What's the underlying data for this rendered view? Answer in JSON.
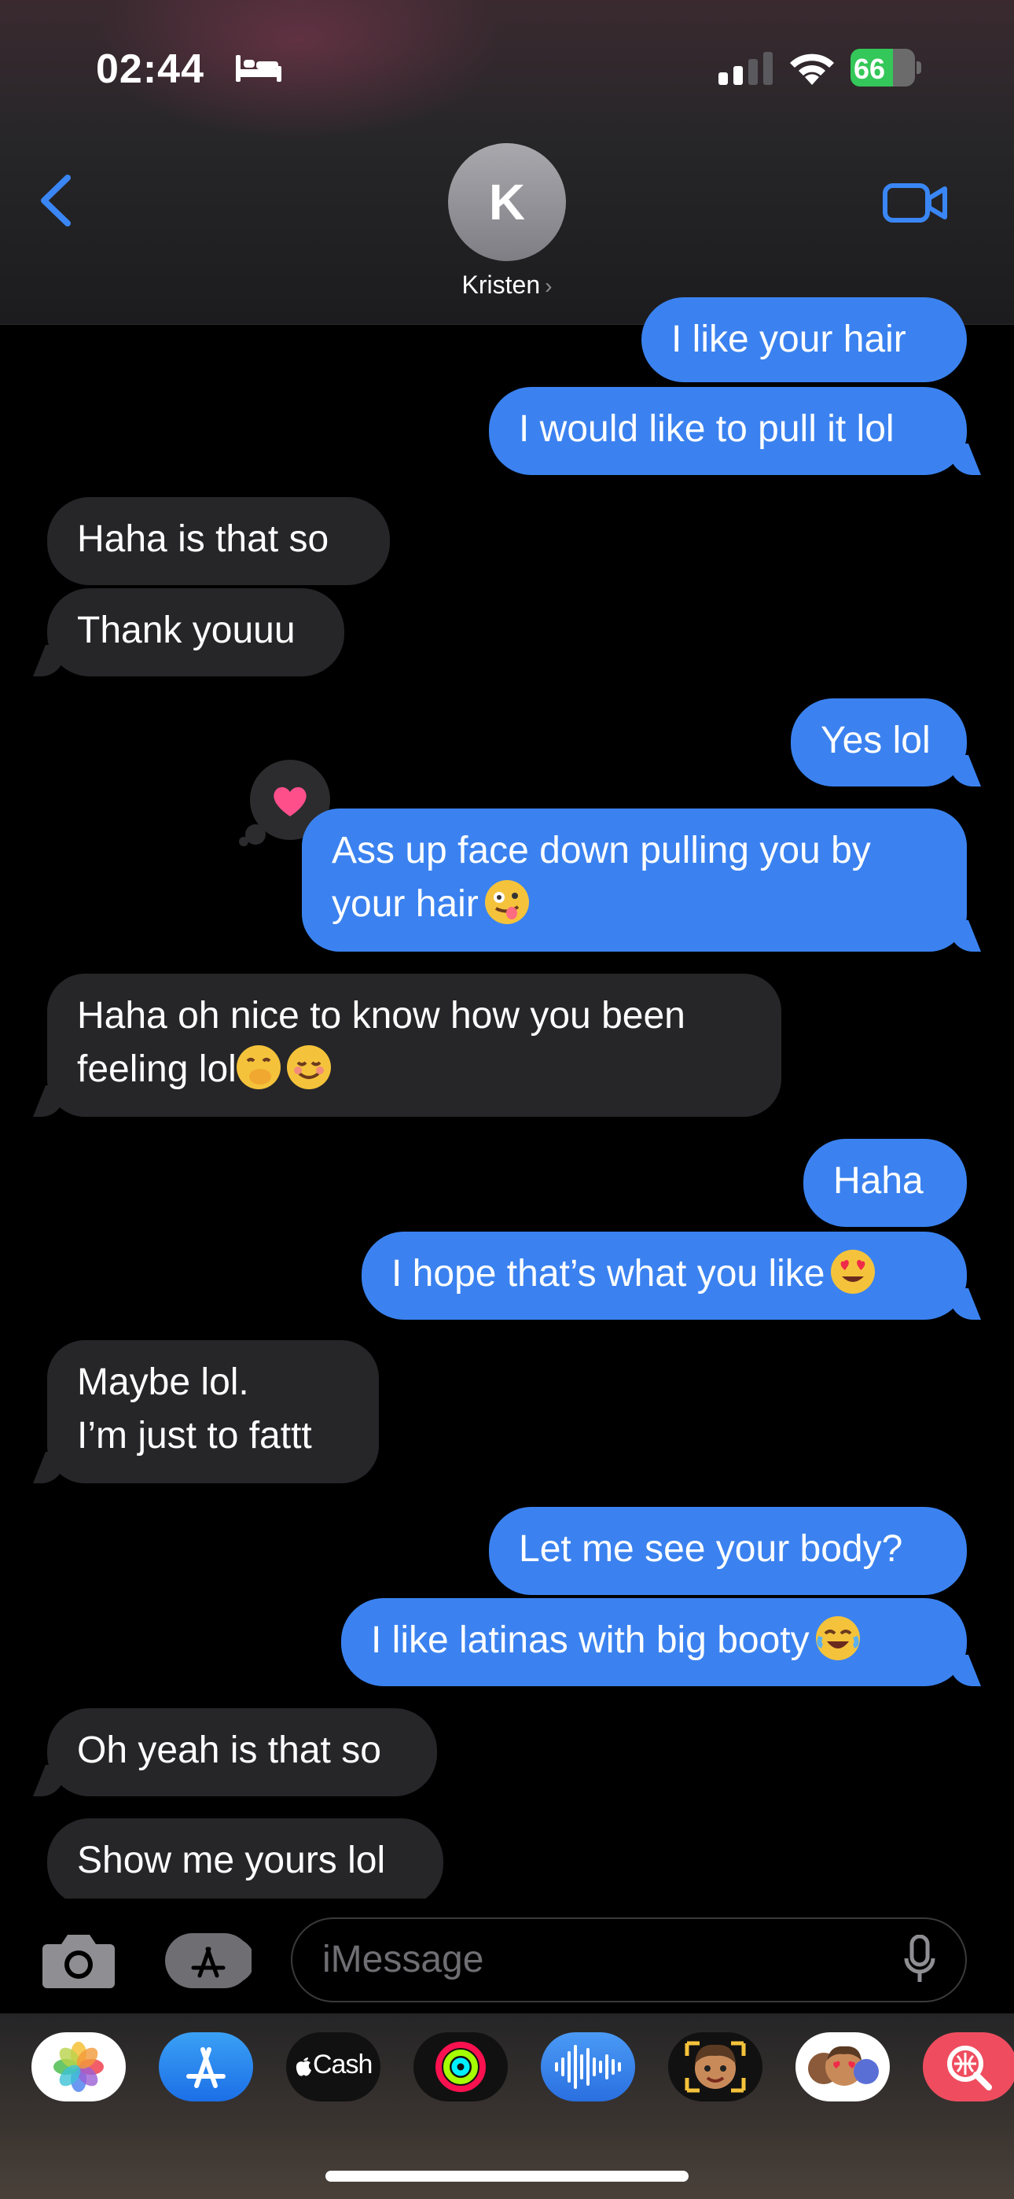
{
  "status_bar": {
    "time": "02:44",
    "battery": "66",
    "battery_fraction": 0.66
  },
  "header": {
    "avatar_initial": "K",
    "contact_name": "Kristen",
    "chevron": "›"
  },
  "messages": [
    {
      "side": "out",
      "text": "I like your hair"
    },
    {
      "side": "out",
      "text": "I would like to pull it lol"
    },
    {
      "side": "in",
      "text": "Haha is that so"
    },
    {
      "side": "in",
      "text": "Thank youuu"
    },
    {
      "side": "out",
      "text": "Yes lol"
    },
    {
      "side": "out",
      "line1": "Ass up face down pulling you by",
      "line2": "your hair",
      "emoji": "zany-face",
      "tapback": "heart"
    },
    {
      "side": "in",
      "line1": "Haha oh nice to know how you been",
      "line2": "feeling lol",
      "emoji": [
        "hand-over-mouth",
        "smiling-face"
      ]
    },
    {
      "side": "out",
      "text": "Haha"
    },
    {
      "side": "out",
      "text": "I hope that’s what you like",
      "emoji": "heart-eyes"
    },
    {
      "side": "in",
      "line1": "Maybe lol.",
      "line2": "I’m just to fattt"
    },
    {
      "side": "out",
      "text": "Let me see your body?"
    },
    {
      "side": "out",
      "text": "I like latinas with big booty",
      "emoji": "tears-of-joy"
    },
    {
      "side": "in",
      "text": "Oh yeah is that so"
    },
    {
      "side": "in",
      "text": "Show me yours lol"
    }
  ],
  "input": {
    "placeholder": "iMessage"
  },
  "app_strip": [
    {
      "name": "Photos",
      "icon": "photos-icon"
    },
    {
      "name": "App Store",
      "icon": "app-store-icon"
    },
    {
      "name": "Cash",
      "label": "Cash",
      "icon": "apple-cash-icon"
    },
    {
      "name": "Activity",
      "icon": "activity-icon"
    },
    {
      "name": "Audio",
      "icon": "audio-message-icon"
    },
    {
      "name": "Memoji",
      "icon": "memoji-icon"
    },
    {
      "name": "Memoji Stickers",
      "icon": "memoji-stickers-icon"
    },
    {
      "name": "Search",
      "icon": "image-search-icon"
    }
  ],
  "colors": {
    "outgoing": "#3b82f0",
    "incoming": "#262629",
    "accent": "#3a86f5",
    "battery": "#34c759"
  }
}
